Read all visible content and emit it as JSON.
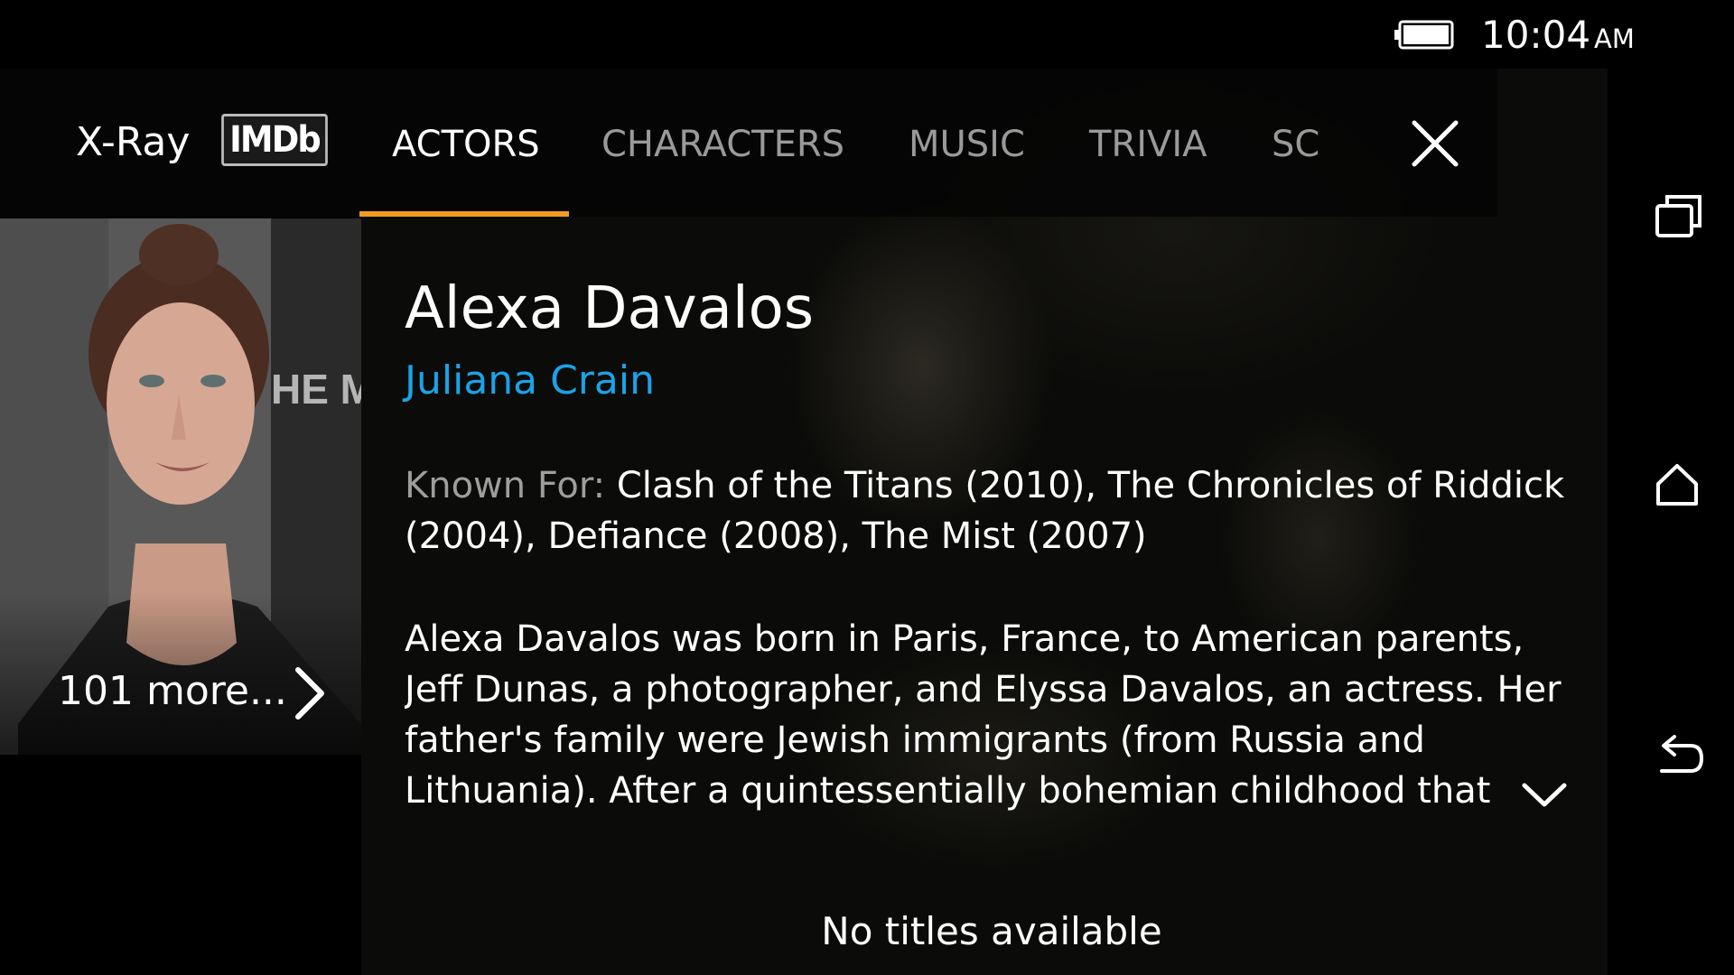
{
  "status_bar": {
    "time": "10:04",
    "ampm": "AM",
    "battery_icon": "battery-full-icon"
  },
  "header": {
    "xray_label": "X-Ray",
    "imdb_logo": "IMDb",
    "tabs": [
      {
        "label": "ACTORS",
        "active": true
      },
      {
        "label": "CHARACTERS",
        "active": false
      },
      {
        "label": "MUSIC",
        "active": false
      },
      {
        "label": "TRIVIA",
        "active": false
      },
      {
        "label": "SC",
        "active": false
      }
    ],
    "close_icon": "close-icon",
    "accent_color": "#f39b1f"
  },
  "actor": {
    "photo": "actor-portrait",
    "more_label": "101 more...",
    "name": "Alexa Davalos",
    "character": "Juliana Crain",
    "character_color": "#1aa3e8",
    "known_for_label": "Known For:",
    "known_for": "Clash of the Titans (2010), The Chronicles of Riddick (2004), Defiance (2008), The Mist (2007)",
    "bio": "Alexa Davalos was born in Paris, France, to American parents, Jeff Dunas, a photographer, and Elyssa Davalos, an actress. Her father's family were Jewish immigrants (from Russia and Lithuania). After a quintessentially bohemian childhood that"
  },
  "footer": {
    "no_titles": "No titles available"
  },
  "nav_bar": {
    "icons": [
      "recents-icon",
      "home-icon",
      "back-icon"
    ]
  }
}
